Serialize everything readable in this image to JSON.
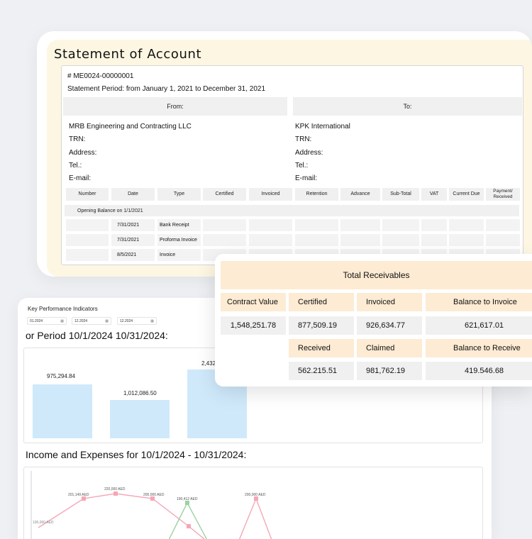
{
  "statement": {
    "title": "Statement of Account",
    "number": "# ME0024-00000001",
    "period": "Statement Period: from January 1, 2021 to December 31, 2021",
    "from_label": "From:",
    "to_label": "To:",
    "from": {
      "company": "MRB Engineering and Contracting LLC",
      "trn": "TRN:",
      "address": "Address:",
      "tel": "Tel.:",
      "email": "E-mail:"
    },
    "to": {
      "company": "KPK International",
      "trn": "TRN:",
      "address": "Address:",
      "tel": "Tel.:",
      "email": "E-mail:"
    },
    "columns": [
      "Number",
      "Date",
      "Type",
      "Certified",
      "Invoiced",
      "Retention",
      "Advance",
      "Sub-Total",
      "VAT",
      "Current Due",
      "Payment/\nReceived"
    ],
    "opening_balance": "Opening Balance on 1/1/2021",
    "rows": [
      {
        "date": "7/31/2021",
        "type": "Bank Receipt"
      },
      {
        "date": "7/31/2021",
        "type": "Proforma Invoice"
      },
      {
        "date": "8/5/2021",
        "type": "Invoice"
      }
    ]
  },
  "kpi": {
    "label": "Key Performance Indicators",
    "date_from": "01.2024",
    "date_to": "12.2024",
    "date_extra": "12.2024",
    "period_title": "or Period 10/1/2024 10/31/2024:",
    "bars": [
      {
        "label": "975,294.84",
        "value": 975294.84
      },
      {
        "label": "1,012,086.50",
        "value": 1012086.5
      },
      {
        "label": "2,432,",
        "value": 2432000
      }
    ],
    "income_title": "Income and Expenses for 10/1/2024 - 10/31/2024:",
    "line_labels": [
      "100,000 AED",
      "201,149 AED",
      "220,000 AED",
      "200,000 AED",
      "190,412 AED",
      "200,000 AED"
    ],
    "colors": {
      "bar": "#cfe9fb",
      "income_line": "#f4a7b6",
      "expense_line": "#9bd3a4"
    }
  },
  "receivables": {
    "title": "Total Receivables",
    "contract_value_label": "Contract Value",
    "contract_value": "1,548,251.78",
    "certified_label": "Certified",
    "certified": "877,509.19",
    "invoiced_label": "Invoiced",
    "invoiced": "926,634.77",
    "balance_to_invoice_label": "Balance to Invoice",
    "balance_to_invoice": "621,617.01",
    "received_label": "Received",
    "received": "562.215.51",
    "claimed_label": "Claimed",
    "claimed": "981,762.19",
    "balance_to_receive_label": "Balance to Receive",
    "balance_to_receive": "419.546.68",
    "colors": {
      "header": "#fdebd3",
      "value": "#f0f0f0"
    }
  }
}
